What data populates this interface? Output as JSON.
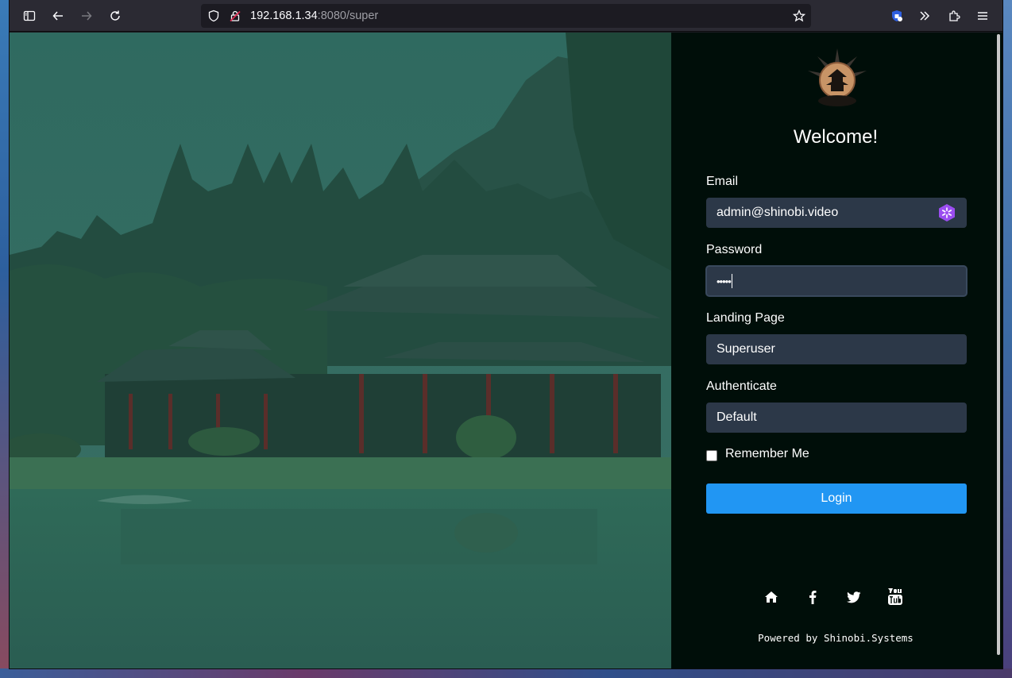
{
  "browser": {
    "url_host": "192.168.1.34",
    "url_rest": ":8080/super"
  },
  "login": {
    "welcome": "Welcome!",
    "email_label": "Email",
    "email_value": "admin@shinobi.video",
    "password_label": "Password",
    "password_masked": "•••••",
    "landing_label": "Landing Page",
    "landing_value": "Superuser",
    "auth_label": "Authenticate",
    "auth_value": "Default",
    "remember_label": "Remember Me",
    "login_button": "Login",
    "powered_by": "Powered by Shinobi.Systems"
  },
  "icons": {
    "social": [
      "home-icon",
      "facebook-icon",
      "twitter-icon",
      "youtube-icon"
    ]
  },
  "colors": {
    "panel_bg": "#000e09",
    "input_bg": "#2c3848",
    "login_button": "#2196f3",
    "scene_tint": "#2c5d55"
  }
}
